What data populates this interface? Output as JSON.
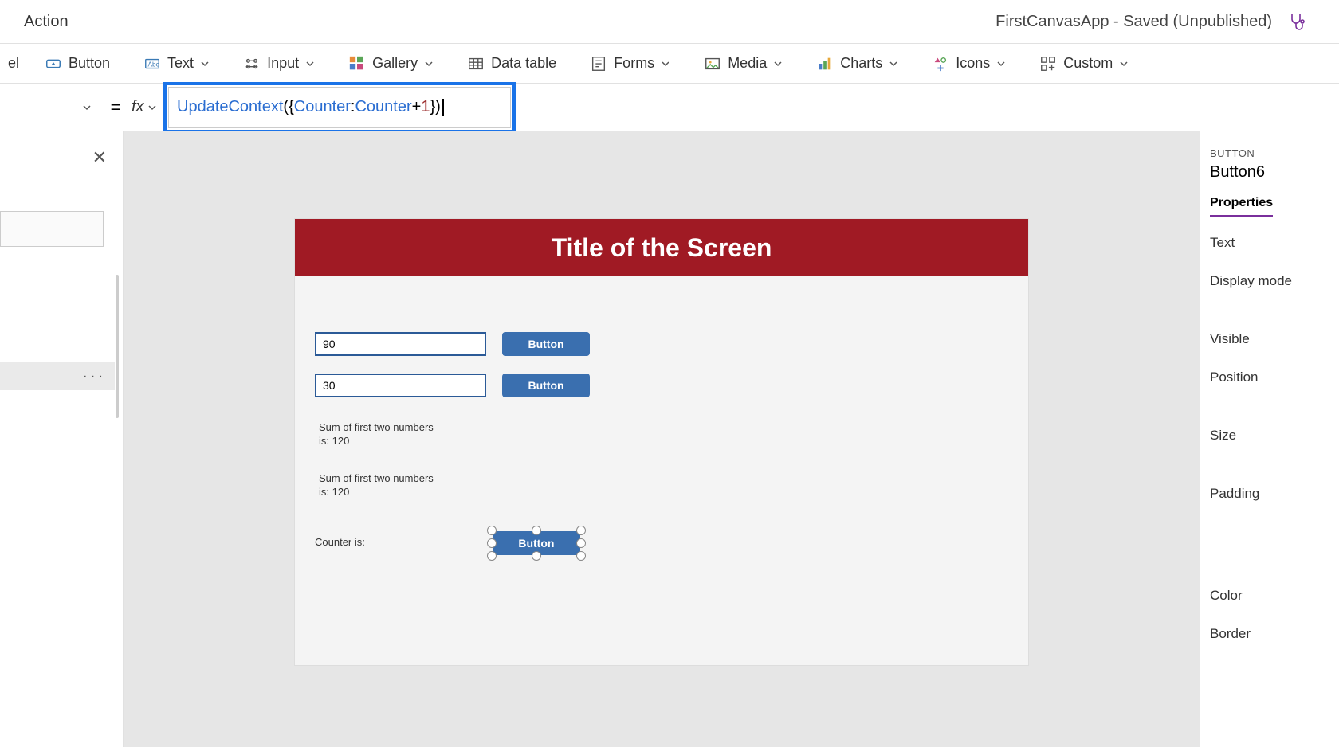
{
  "topbar": {
    "menu_action": "Action",
    "title_status": "FirstCanvasApp - Saved (Unpublished)"
  },
  "toolbar": {
    "label_partial": "el",
    "button": "Button",
    "text": "Text",
    "input": "Input",
    "gallery": "Gallery",
    "data_table": "Data table",
    "forms": "Forms",
    "media": "Media",
    "charts": "Charts",
    "icons": "Icons",
    "custom": "Custom"
  },
  "formula": {
    "equals": "=",
    "fx": "fx",
    "fn": "UpdateContext",
    "open": "({",
    "field": "Counter",
    "colon": ": ",
    "var": "Counter",
    "plus": " + ",
    "num": "1",
    "close": "})"
  },
  "left": {
    "close": "✕",
    "ellipsis": "· · ·"
  },
  "canvas": {
    "title": "Title of the Screen",
    "input1": "90",
    "input2": "30",
    "btn1": "Button",
    "btn2": "Button",
    "sum1": "Sum of first two numbers is: 120",
    "sum2": "Sum of first two numbers is: 120",
    "counter_label": "Counter is:",
    "selected_btn": "Button"
  },
  "props": {
    "category": "BUTTON",
    "name": "Button6",
    "tab": "Properties",
    "items": {
      "text": "Text",
      "display_mode": "Display mode",
      "visible": "Visible",
      "position": "Position",
      "size": "Size",
      "padding": "Padding",
      "color": "Color",
      "border": "Border"
    }
  }
}
